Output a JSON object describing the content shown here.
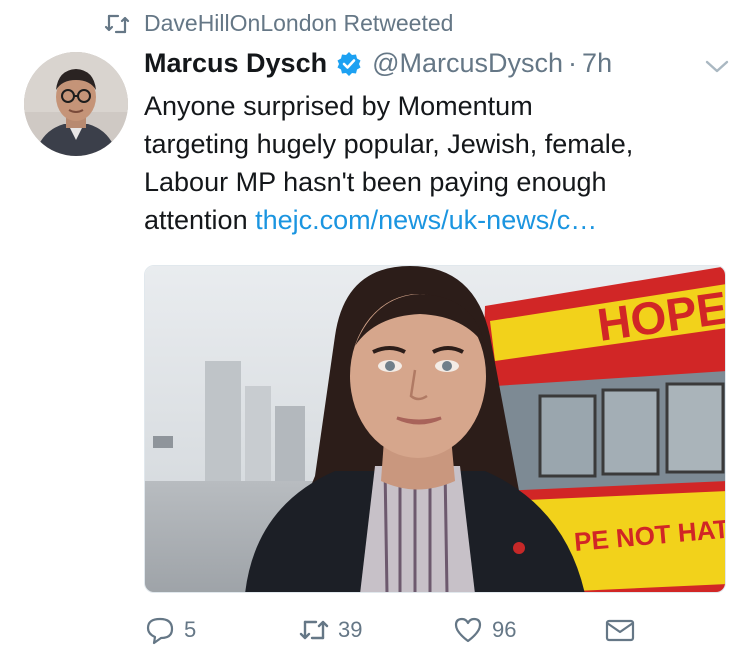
{
  "retweet": {
    "icon": "retweet-icon",
    "label": "DaveHillOnLondon Retweeted"
  },
  "tweet": {
    "author_name": "Marcus Dysch",
    "verified": true,
    "handle": "@MarcusDysch",
    "separator": "·",
    "time": "7h",
    "text_lines": [
      "Anyone surprised by Momentum",
      "targeting hugely popular, Jewish, female,",
      "Labour MP hasn't been paying enough"
    ],
    "last_line_text": "attention ",
    "link_text": "thejc.com/news/uk-news/c…",
    "media_texts": {
      "bus_banner": "HOPE",
      "bus_banner_bottom": "PE NOT HATE"
    }
  },
  "actions": {
    "reply": {
      "icon": "reply-icon",
      "count": "5"
    },
    "retweet": {
      "icon": "retweet-icon",
      "count": "39"
    },
    "like": {
      "icon": "heart-icon",
      "count": "96"
    },
    "message": {
      "icon": "envelope-icon"
    }
  },
  "colors": {
    "link": "#1b95e0",
    "secondary": "#657786",
    "verified": "#1da1f2",
    "text": "#14171a"
  }
}
